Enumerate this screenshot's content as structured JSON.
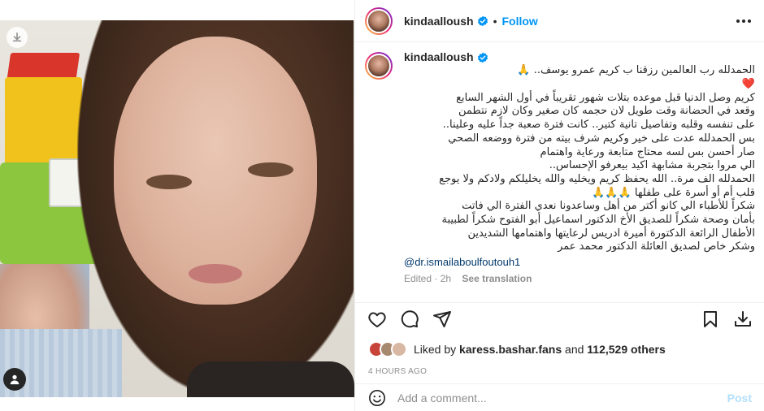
{
  "post": {
    "username": "kindaalloush",
    "follow_label": "Follow",
    "verified_icon": "verified-badge-icon",
    "caption": {
      "username": "kindaalloush",
      "text": "الحمدلله رب العالمين رزقنا ب كريم عمرو يوسف.. 🙏\n❤️\nكريم وصل الدنيا قبل موعده بتلات شهور تقريباً في أول الشهر السابع\nوقعد في الحضانة وقت طويل لان حجمه كان صغير وكان لازم نتطمن\nعلى تنفسه وقلبه وتفاصيل تانية كتير.. كانت فترة صعبة جداً عليه وعلينا..\nبس الحمدلله عدت على خير وكريم شرف بيته من فترة ووضعه الصحي\nصار أحسن بس لسه محتاج متابعة ورعاية واهتمام\nالي مروا بتجربة مشابهة اكيد بيعرفو الإحساس..\nالحمدلله الف مرة.. الله يحفظ كريم ويخليه والله يخليلكم ولادكم ولا يوجع\nقلب أم أو أسرة على طفلها 🙏🙏🙏\nشكراً للأطباء الي كانو أكتر من أهل وساعدونا نعدي الفترة الي فاتت\nبأمان وصحة شكراً للصديق الأخ الدكتور اسماعيل أبو الفتوح شكراً لطبيبة\nالأطفال الرائعة الدكتورة أميرة ادريس لرعايتها واهتمامها الشديدين\nوشكر خاص لصديق العائلة الدكتور محمد عمر",
      "mention": "@dr.ismailaboulfoutouh1",
      "edited": "Edited · 2h",
      "see_translation": "See translation"
    },
    "likes": {
      "prefix": "Liked by",
      "user": "karess.bashar.fans",
      "connector": "and",
      "count": "112,529 others"
    },
    "timestamp": "4 HOURS AGO",
    "comment": {
      "placeholder": "Add a comment...",
      "post_label": "Post"
    }
  },
  "icons": {
    "like": "heart-icon",
    "comment": "comment-icon",
    "share": "paper-plane-icon",
    "save": "bookmark-icon",
    "download": "download-icon",
    "emoji": "smiley-icon",
    "tag": "user-tag-icon"
  },
  "colors": {
    "accent": "#0095f6",
    "text": "#262626",
    "secondary": "#8e8e8e",
    "mention": "#00376b",
    "post_disabled": "#b2dffc"
  }
}
